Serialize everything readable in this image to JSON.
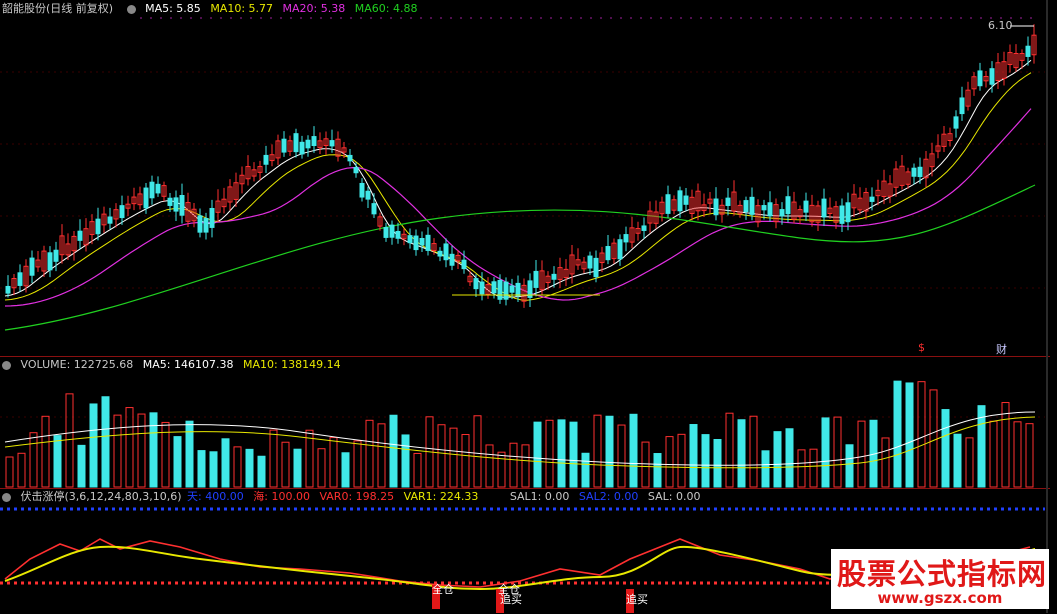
{
  "main_panel": {
    "title": "韶能股份(日线 前复权)",
    "ma5": "MA5: 5.85",
    "ma10": "MA10: 5.77",
    "ma20": "MA20: 5.38",
    "ma60": "MA60: 4.88",
    "price_high_label": "6.10",
    "markers": [
      "$",
      "财"
    ],
    "colors": {
      "ma5": "#ffffff",
      "ma10": "#e8e800",
      "ma20": "#e030e0",
      "ma60": "#20d020",
      "up": "#ff3030",
      "down": "#40e8e8"
    }
  },
  "volume_panel": {
    "volume": "VOLUME: 122725.68",
    "ma5": "MA5: 146107.38",
    "ma10": "MA10: 138149.14"
  },
  "indicator_panel": {
    "name": "伏击涨停(3,6,12,24,80,3,10,6)",
    "tian": "天: 400.00",
    "hai": "海: 100.00",
    "var0": "VAR0: 198.25",
    "var1": "VAR1: 224.33",
    "sal1": "SAL1: 0.00",
    "sal2": "SAL2: 0.00",
    "sal": "SAL: 0.00",
    "signals": [
      "全仓",
      "全仓",
      "追买",
      "追买"
    ]
  },
  "watermark": {
    "title": "股票公式指标网",
    "url": "www.gszx.com"
  },
  "chart_data": {
    "type": "candlestick",
    "title": "韶能股份(日线 前复权)",
    "price_max_label": 6.1,
    "ma_values": {
      "MA5": 5.85,
      "MA10": 5.77,
      "MA20": 5.38,
      "MA60": 4.88
    },
    "volume": 122725.68,
    "volume_ma5": 146107.38,
    "volume_ma10": 138149.14
  }
}
